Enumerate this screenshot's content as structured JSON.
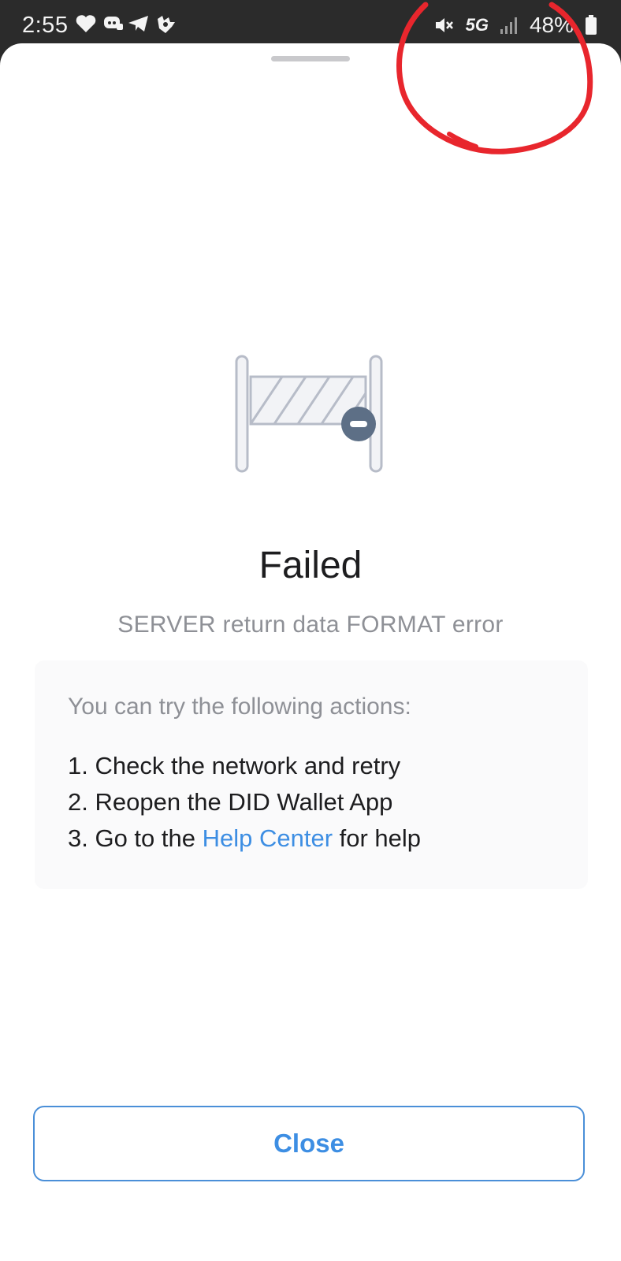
{
  "status_bar": {
    "time": "2:55",
    "network": "5G",
    "battery": "48%",
    "icons": [
      "heart-icon",
      "discord-icon",
      "telegram-icon",
      "app-icon",
      "mute-icon",
      "signal-icon",
      "battery-icon"
    ]
  },
  "dialog": {
    "illustration": "barrier-icon",
    "title": "Failed",
    "subtitle": "SERVER return data FORMAT error",
    "actions_header": "You can try the following actions:",
    "actions": [
      {
        "text": "1. Check the network and retry"
      },
      {
        "text": "2. Reopen the DID Wallet App"
      },
      {
        "prefix": "3. Go to the ",
        "link": "Help Center",
        "suffix": " for help"
      }
    ],
    "close_label": "Close"
  },
  "colors": {
    "accent": "#3d8ee3",
    "annotation": "#e8262d",
    "muted_text": "#8e9096"
  }
}
